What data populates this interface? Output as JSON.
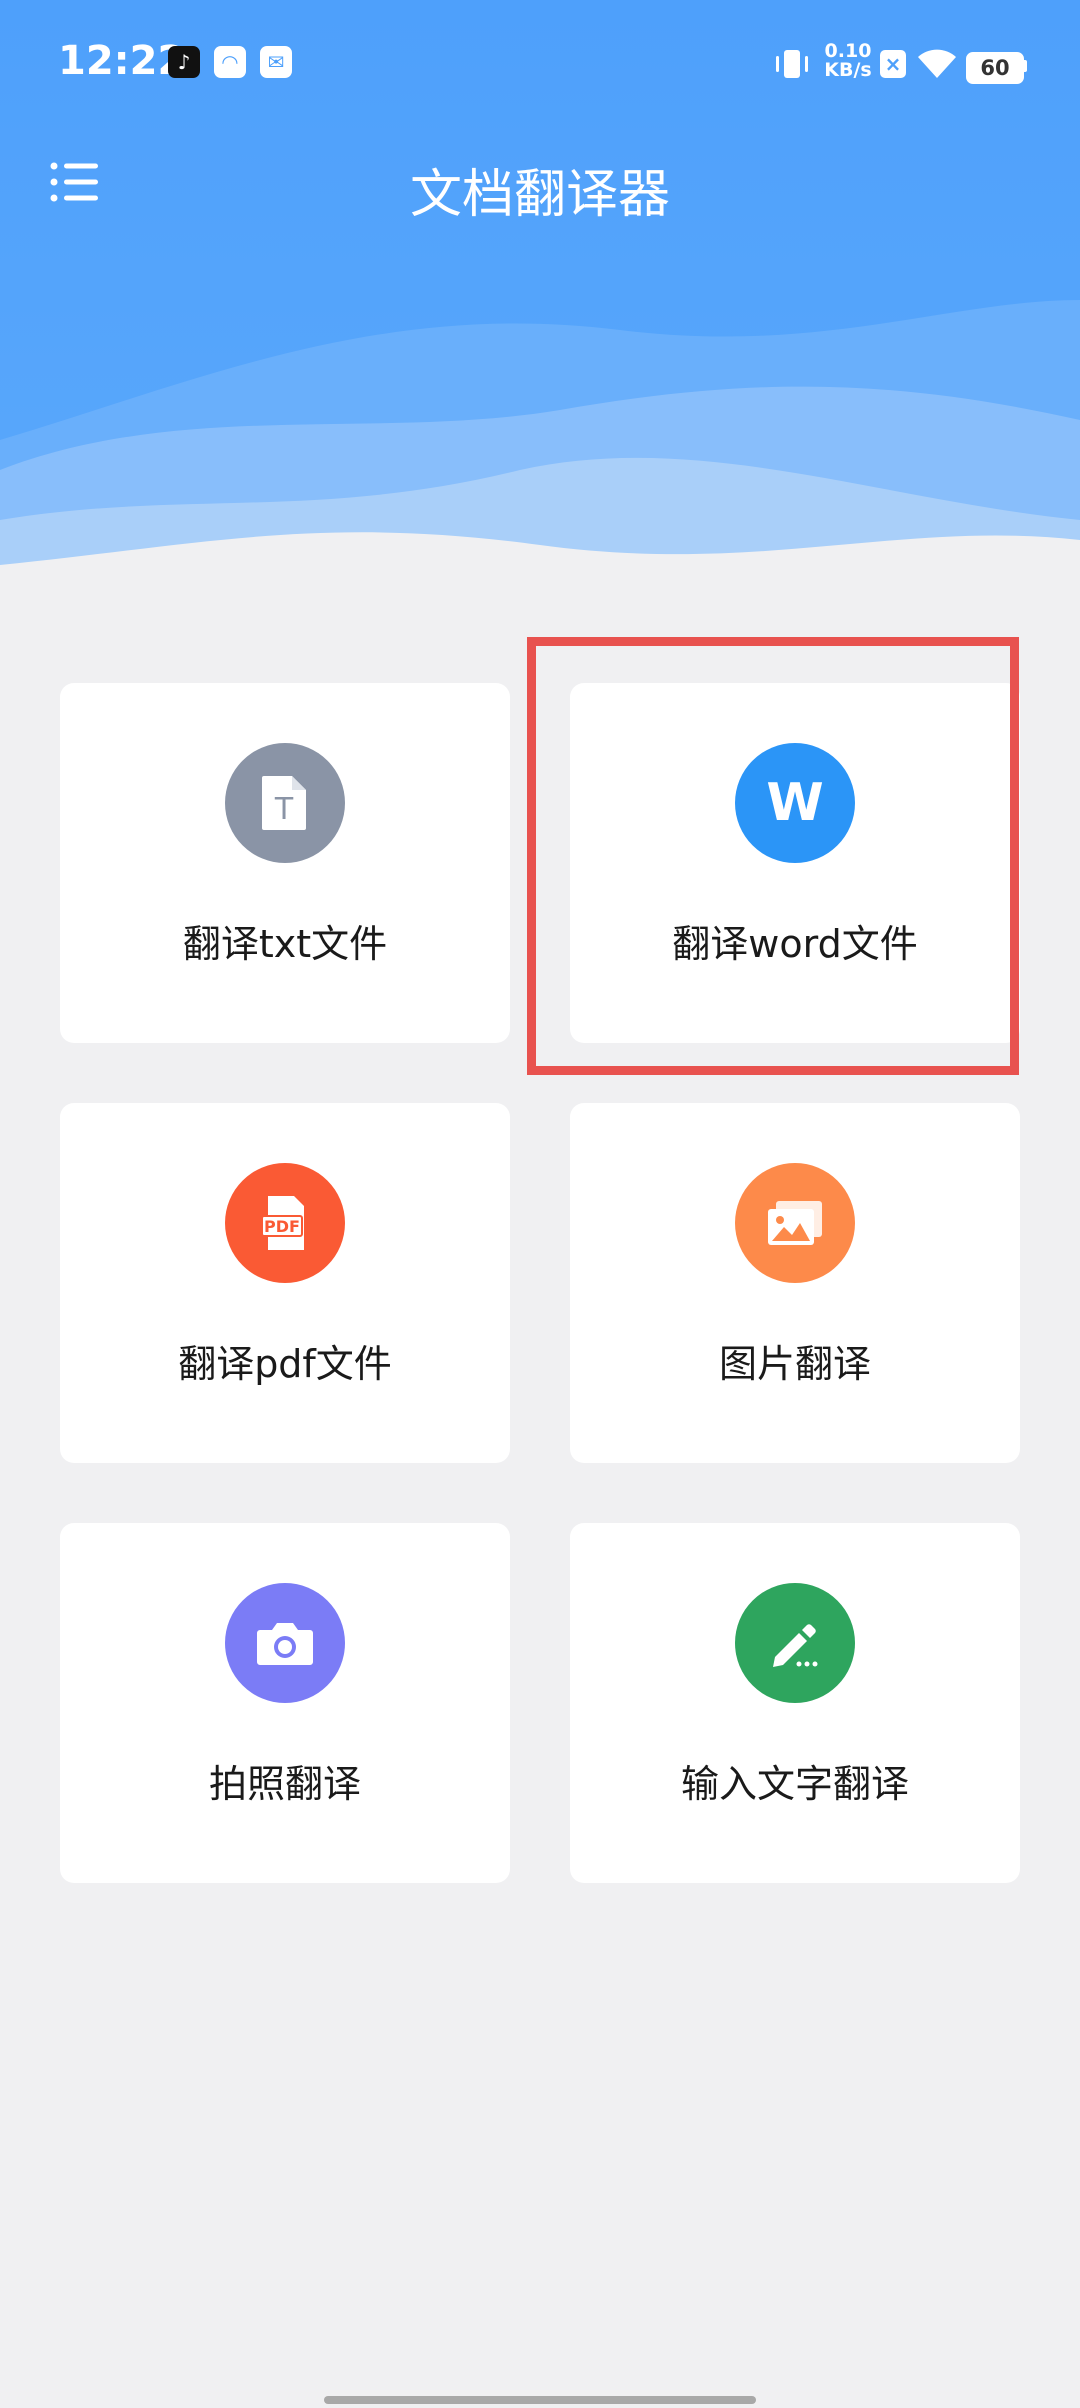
{
  "status_bar": {
    "time": "12:22",
    "net_speed_value": "0.10",
    "net_speed_unit": "KB/s",
    "battery": "60"
  },
  "header": {
    "title": "文档翻译器"
  },
  "cards": [
    {
      "label": "翻译txt文件",
      "icon": "txt-file-icon",
      "color": "#8a94a6"
    },
    {
      "label": "翻译word文件",
      "icon": "word-file-icon",
      "icon_text": "W",
      "color": "#2b95f7"
    },
    {
      "label": "翻译pdf文件",
      "icon": "pdf-file-icon",
      "icon_text": "PDF",
      "color": "#fa5a34"
    },
    {
      "label": "图片翻译",
      "icon": "image-icon",
      "color": "#fd8a4a"
    },
    {
      "label": "拍照翻译",
      "icon": "camera-icon",
      "color": "#7b7cf6"
    },
    {
      "label": "输入文字翻译",
      "icon": "pencil-icon",
      "color": "#2ea55e"
    }
  ],
  "colors": {
    "header_blue": "#4ea0fb",
    "highlight_red": "#e8524f",
    "background": "#f0f0f2"
  }
}
